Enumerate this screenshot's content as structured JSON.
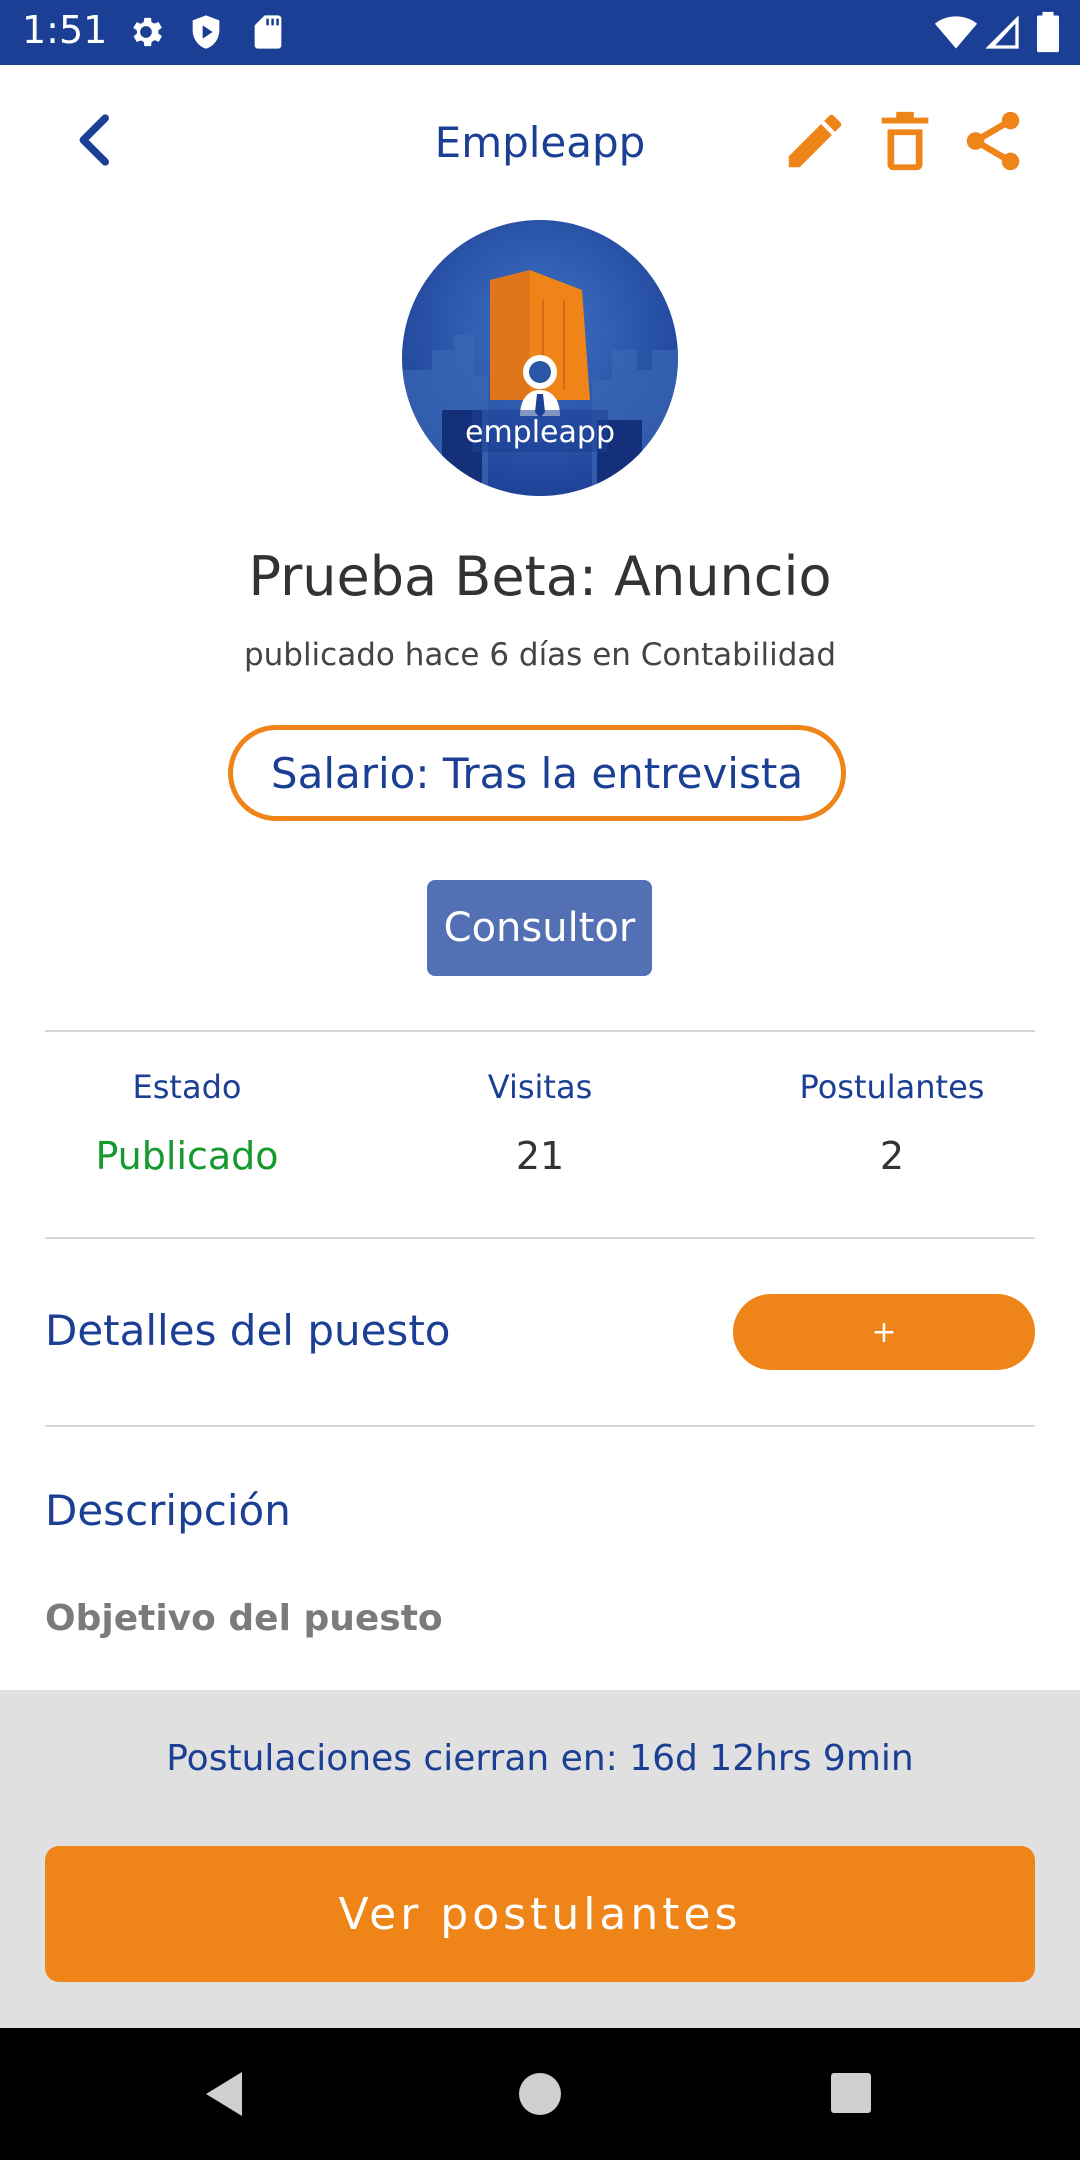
{
  "status_bar": {
    "time": "1:51",
    "left_icons": [
      "gear-icon",
      "shield-play-icon",
      "sd-card-icon"
    ],
    "right_icons": [
      "wifi-icon",
      "signal-icon",
      "battery-icon"
    ],
    "background": "#1b3f94"
  },
  "app_bar": {
    "title": "Empleapp",
    "back_icon": "chevron-left-icon",
    "actions": [
      "pencil-icon",
      "trash-icon",
      "share-icon"
    ]
  },
  "logo": {
    "text": "empleapp"
  },
  "job": {
    "title": "Prueba Beta: Anuncio",
    "subtitle": "publicado hace 6 días en Contabilidad",
    "salary": "Salario: Tras la entrevista",
    "category": "Consultor"
  },
  "stats": [
    {
      "label": "Estado",
      "value": "Publicado"
    },
    {
      "label": "Visitas",
      "value": "21"
    },
    {
      "label": "Postulantes",
      "value": "2"
    }
  ],
  "details": {
    "title": "Detalles del puesto",
    "expand_label": "+"
  },
  "description": {
    "title": "Descripción",
    "subheading": "Objetivo del puesto"
  },
  "footer": {
    "countdown": "Postulaciones cierran en: 16d 12hrs 9min",
    "cta": "Ver postulantes"
  },
  "colors": {
    "primary": "#1b3f94",
    "accent": "#ef8419",
    "category_button": "#5470b4",
    "status_green": "#149a2e"
  },
  "nav_bar": {
    "icons": [
      "back-triangle-icon",
      "home-circle-icon",
      "recents-square-icon"
    ]
  }
}
